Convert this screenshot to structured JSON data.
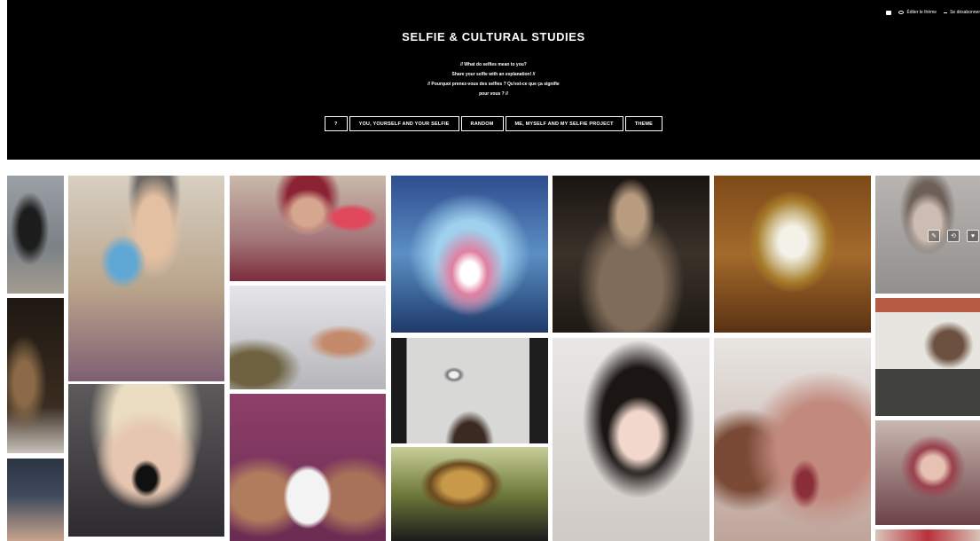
{
  "topbar": {
    "edit_theme": "Éditer le thème",
    "unsubscribe": "Se désabonner"
  },
  "blog": {
    "title": "SELFIE & CULTURAL STUDIES",
    "description": [
      "// What do selfies mean to you?",
      "Share your selfie with an explanation! //",
      "// Pourquoi prenez-vous des selfies ? Qu'est-ce que ça signifie",
      "pour vous ? //"
    ]
  },
  "nav": [
    {
      "label": "?"
    },
    {
      "label": "YOU, YOURSELF AND YOUR SELFIE"
    },
    {
      "label": "RANDOM"
    },
    {
      "label": "ME, MYSELF AND MY SELFIE PROJECT"
    },
    {
      "label": "THEME"
    }
  ],
  "photos": [
    {
      "name": "photo-hooded-figure-beach",
      "bg": "#8a8f93"
    },
    {
      "name": "photo-dark-portrait",
      "bg": "#2d231a"
    },
    {
      "name": "photo-beanie-closeup",
      "bg": "#3c4450"
    },
    {
      "name": "photo-beanie-mirror-phone",
      "bg": "#b59a7c"
    },
    {
      "name": "photo-avocado-nose",
      "bg": "#5a5a5e"
    },
    {
      "name": "photo-watermelon",
      "bg": "#8d3c4a"
    },
    {
      "name": "photo-peace-sign",
      "bg": "#b9b9bd"
    },
    {
      "name": "photo-phone-hands",
      "bg": "#8e4a72"
    },
    {
      "name": "photo-blue-glow",
      "bg": "#4a6f9a"
    },
    {
      "name": "photo-ceiling-lamp",
      "bg": "#9a9a98"
    },
    {
      "name": "photo-monkey-mask",
      "bg": "#6a7a34"
    },
    {
      "name": "photo-blurred-man",
      "bg": "#3d342c"
    },
    {
      "name": "photo-bangs-red-lips",
      "bg": "#2b2420"
    },
    {
      "name": "photo-ornate-mirror",
      "bg": "#8a5a22"
    },
    {
      "name": "photo-bruised-arm",
      "bg": "#b07c6f"
    },
    {
      "name": "photo-girl-hand-face",
      "bg": "#a8a5a3"
    },
    {
      "name": "photo-monkey-shoulder",
      "bg": "#5e5a52"
    },
    {
      "name": "photo-pink-hair",
      "bg": "#7a4a4e"
    },
    {
      "name": "photo-bottom-strip",
      "bg": "#b8323a"
    }
  ],
  "hover_actions": [
    {
      "name": "edit-post-button",
      "icon": "pencil-icon"
    },
    {
      "name": "reblog-button",
      "icon": "reblog-icon"
    },
    {
      "name": "like-button",
      "icon": "heart-icon"
    }
  ]
}
